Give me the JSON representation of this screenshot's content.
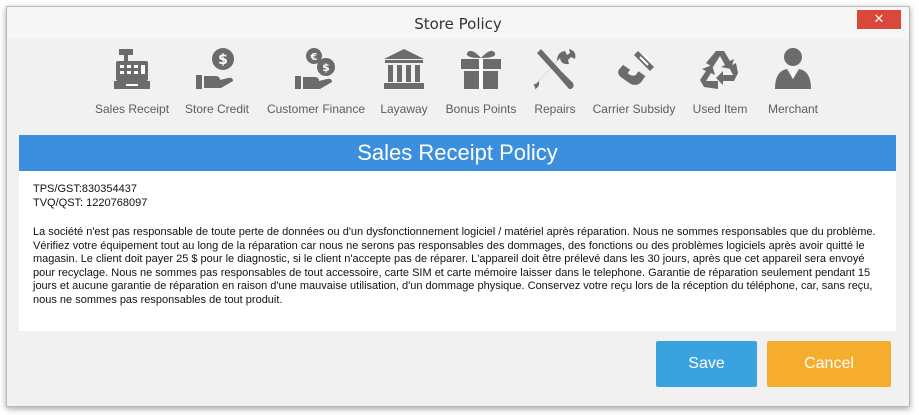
{
  "window": {
    "title": "Store Policy",
    "close_label": "✕"
  },
  "toolbar": {
    "items": [
      {
        "label": "Sales Receipt",
        "icon": "cash-register-icon"
      },
      {
        "label": "Store Credit",
        "icon": "hand-coin-icon"
      },
      {
        "label": "Customer Finance",
        "icon": "hand-euro-coins-icon"
      },
      {
        "label": "Layaway",
        "icon": "bank-building-icon"
      },
      {
        "label": "Bonus Points",
        "icon": "gift-icon"
      },
      {
        "label": "Repairs",
        "icon": "wrench-screwdriver-icon"
      },
      {
        "label": "Carrier Subsidy",
        "icon": "phone-handset-icon"
      },
      {
        "label": "Used Item",
        "icon": "recycle-icon"
      },
      {
        "label": "Merchant",
        "icon": "merchant-person-icon"
      }
    ]
  },
  "policy": {
    "heading": "Sales Receipt Policy",
    "tax_line_1": "TPS/GST:830354437",
    "tax_line_2": "TVQ/QST: 1220768097",
    "body": "La société n'est pas responsable de toute perte de données ou d'un dysfonctionnement logiciel / matériel après réparation. Nous ne sommes responsables que du problème. Vérifiez votre équipement tout au long de la réparation car nous ne serons pas responsables des dommages, des fonctions ou des problèmes logiciels après avoir quitté le magasin. Le client doit payer 25 $ pour le diagnostic, si le client n'accepte pas de réparer. L'appareil doit être prélevé dans les 30 jours, après que cet appareil sera envoyé pour recyclage. Nous ne sommes pas responsables de tout accessoire, carte SIM et carte mémoire laisser dans le telephone. Garantie de réparation seulement pendant 15 jours et aucune garantie de réparation en raison d'une mauvaise utilisation, d'un dommage physique. Conservez votre reçu lors de la réception du téléphone, car, sans reçu, nous ne sommes pas responsables de tout produit."
  },
  "footer": {
    "save_label": "Save",
    "cancel_label": "Cancel"
  },
  "colors": {
    "banner": "#3c8fdf",
    "save": "#3aa3df",
    "cancel": "#f6ad2e",
    "close": "#d9483b",
    "icon": "#6b6b6b"
  }
}
